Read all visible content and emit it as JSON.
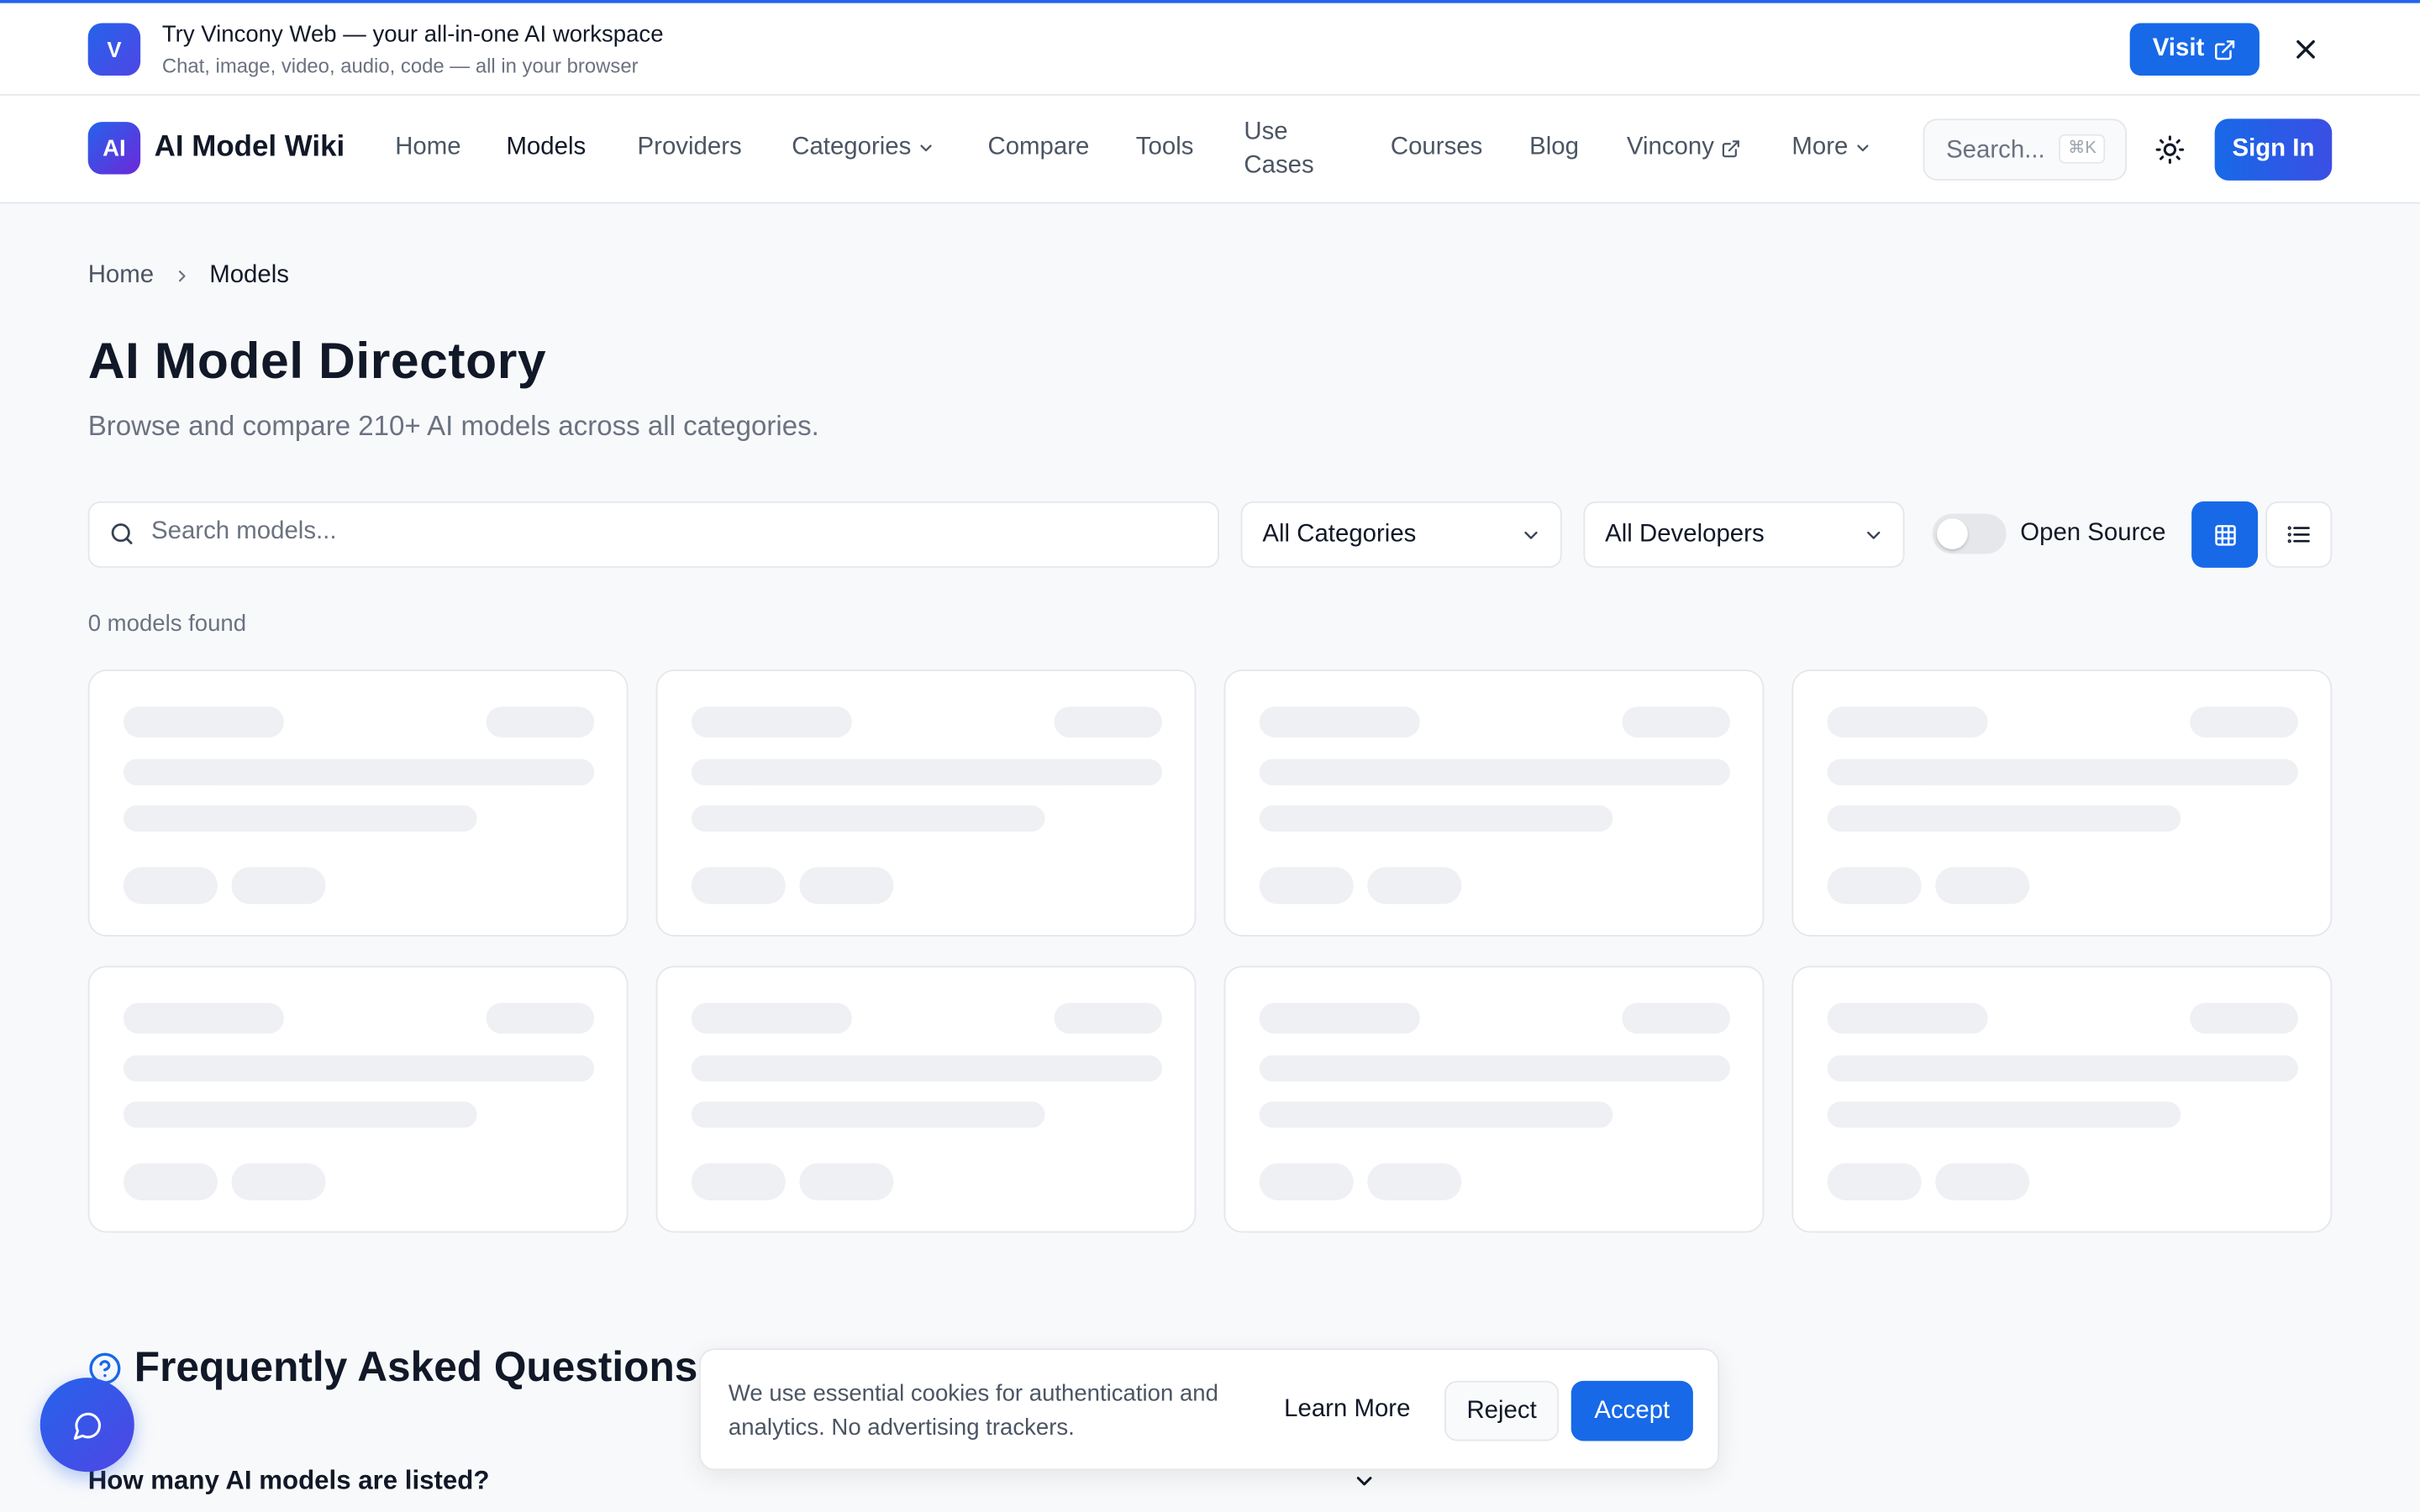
{
  "promo": {
    "logo_letter": "V",
    "title": "Try Vincony Web — your all-in-one AI workspace",
    "subtitle": "Chat, image, video, audio, code — all in your browser",
    "visit_label": "Visit"
  },
  "nav": {
    "logo_letters": "AI",
    "brand": "AI Model Wiki",
    "items": [
      "Home",
      "Models",
      "Providers",
      "Categories",
      "Compare",
      "Tools",
      "Use Cases",
      "Courses",
      "Blog",
      "Vincony",
      "More"
    ],
    "search_placeholder": "Search...",
    "search_shortcut": "⌘K",
    "signin_label": "Sign In"
  },
  "breadcrumb": {
    "home": "Home",
    "current": "Models"
  },
  "page": {
    "title": "AI Model Directory",
    "subtitle": "Browse and compare 210+ AI models across all categories."
  },
  "filters": {
    "search_placeholder": "Search models...",
    "category": "All Categories",
    "developer": "All Developers",
    "open_source_label": "Open Source",
    "open_source_on": false,
    "view_mode": "grid"
  },
  "results": {
    "count_text": "0 models found",
    "skeleton_cards": 8
  },
  "faq": {
    "heading": "Frequently Asked Questions",
    "first_question": "How many AI models are listed?"
  },
  "cookie": {
    "message": "We use essential cookies for authentication and analytics. No advertising trackers.",
    "learn_more": "Learn More",
    "reject": "Reject",
    "accept": "Accept"
  },
  "colors": {
    "accent": "#1769e8",
    "gradient_end": "#4f46e5"
  }
}
